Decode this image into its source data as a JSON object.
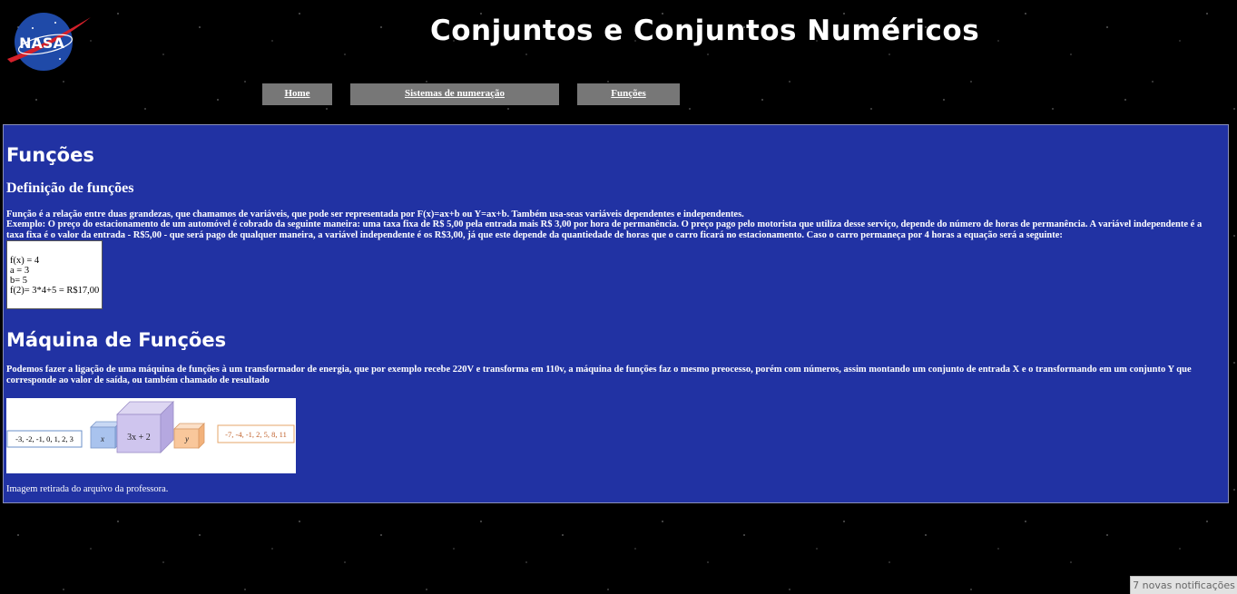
{
  "logo": {
    "text": "NASA",
    "icon": "nasa-logo"
  },
  "header": {
    "title": "Conjuntos e Conjuntos Numéricos"
  },
  "nav": {
    "home": "Home",
    "sistemas": "Sistemas de numeração",
    "funcoes": "Funções"
  },
  "content": {
    "title": "Funções",
    "definition_title": "Definição de funções",
    "definition_text": "Função é a relação entre duas grandezas, que chamamos de variáveis, que pode ser representada por F(x)=ax+b ou Y=ax+b. Também usa-seas variáveis dependentes e independentes.",
    "example_text": "Exemplo: O preço do estacionamento de um automóvel é cobrado da seguinte maneira: uma taxa fixa de R$ 5,00 pela entrada mais R$ 3,00 por hora de permanência. O preço pago pelo motorista que utiliza desse serviço, depende do número de horas de permanência. A variável independente é a taxa fixa é o valor da entrada - R$5,00 - que será pago de qualquer maneira, a variável independente é os R$3,00, já que este depende da quantiedade de horas que o carro ficará no estacionamento. Caso o carro permaneça por 4 horas a equação será a seguinte:",
    "example_lines": [
      "f(x) = 4",
      "a = 3",
      "b= 5",
      "f(2)= 3*4+5 = R$17,00"
    ],
    "machine_title": "Máquina de Funções",
    "machine_text": "Podemos fazer a ligação de uma máquina de funções à um transformador de energia, que por exemplo recebe 220V e transforma em 110v, a máquina de funções faz o mesmo preocesso, porém com números, assim montando um conjunto de entrada X e o transformando em um conjunto Y que corresponde ao valor de saída, ou também chamado de resultado",
    "image": {
      "input_set": "-3, -2, -1, 0, 1, 2, 3",
      "x_label": "x",
      "function": "3x + 2",
      "y_label": "y",
      "output_set": "-7, -4, -1, 2, 5, 8, 11"
    },
    "caption": "Imagem retirada do arquivo da professora."
  },
  "notification": "7 novas notificações"
}
